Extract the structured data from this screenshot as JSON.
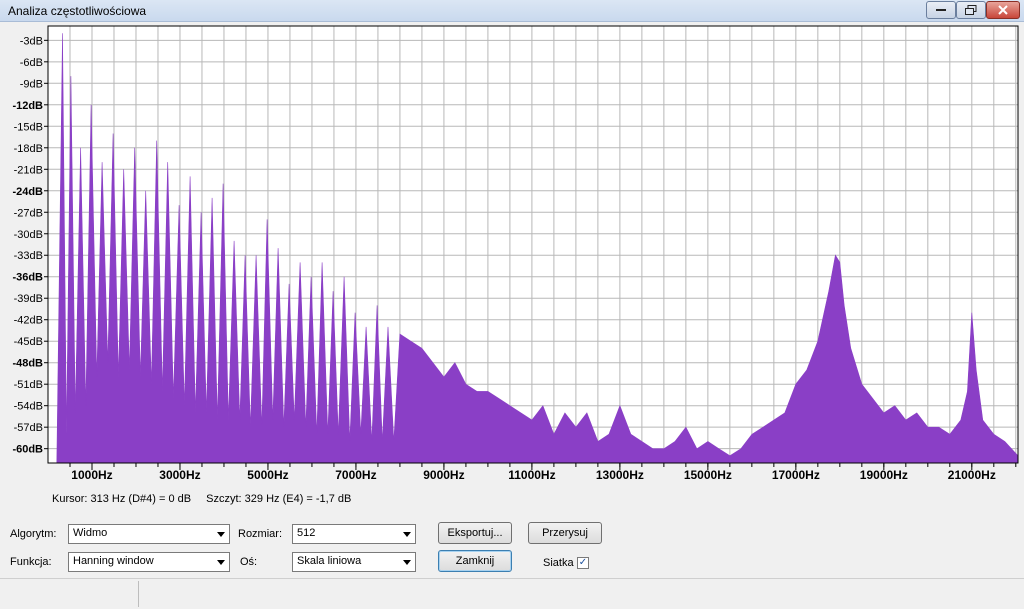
{
  "window": {
    "title": "Analiza częstotliwościowa"
  },
  "chart_data": {
    "type": "area",
    "title": "",
    "xlabel": "",
    "ylabel": "",
    "y_ticks": [
      "-3dB",
      "-6dB",
      "-9dB",
      "-12dB",
      "-15dB",
      "-18dB",
      "-21dB",
      "-24dB",
      "-27dB",
      "-30dB",
      "-33dB",
      "-36dB",
      "-39dB",
      "-42dB",
      "-45dB",
      "-48dB",
      "-51dB",
      "-54dB",
      "-57dB",
      "-60dB"
    ],
    "x_ticks": [
      "1000Hz",
      "3000Hz",
      "5000Hz",
      "7000Hz",
      "9000Hz",
      "11000Hz",
      "13000Hz",
      "15000Hz",
      "17000Hz",
      "19000Hz",
      "21000Hz"
    ],
    "x_unit": "Hz",
    "y_unit": "dB",
    "xlim": [
      0,
      22050
    ],
    "ylim": [
      -62,
      -1
    ],
    "grid": true,
    "color": "#8a3fc6",
    "series": [
      {
        "x": [
          200,
          330,
          420,
          520,
          620,
          740,
          860,
          980,
          1110,
          1230,
          1360,
          1480,
          1600,
          1720,
          1850,
          1970,
          2100,
          2220,
          2350,
          2470,
          2600,
          2720,
          2850,
          2980,
          3100,
          3230,
          3350,
          3480,
          3600,
          3730,
          3850,
          3980,
          4100,
          4230,
          4360,
          4480,
          4600,
          4730,
          4860,
          4980,
          5110,
          5230,
          5360,
          5480,
          5600,
          5730,
          5860,
          5980,
          6110,
          6230,
          6360,
          6480,
          6600,
          6730,
          6860,
          6980,
          7110,
          7230,
          7360,
          7480,
          7600,
          7730,
          7860,
          8000,
          8250,
          8500,
          8750,
          9000,
          9250,
          9500,
          9750,
          10000,
          10250,
          10500,
          10750,
          11000,
          11250,
          11500,
          11750,
          12000,
          12250,
          12500,
          12750,
          13000,
          13250,
          13500,
          13750,
          14000,
          14250,
          14500,
          14750,
          15000,
          15250,
          15500,
          15750,
          16000,
          16250,
          16500,
          16750,
          17000,
          17250,
          17500,
          17750,
          17900,
          18000,
          18100,
          18250,
          18500,
          18750,
          19000,
          19250,
          19500,
          19750,
          20000,
          20250,
          20500,
          20750,
          20900,
          21000,
          21100,
          21250,
          21500,
          21750,
          22050
        ],
        "y": [
          -62,
          -2,
          -58,
          -8,
          -55,
          -18,
          -54,
          -12,
          -50,
          -20,
          -48,
          -16,
          -50,
          -21,
          -49,
          -18,
          -50,
          -24,
          -51,
          -17,
          -52,
          -20,
          -53,
          -26,
          -54,
          -22,
          -55,
          -27,
          -55,
          -25,
          -56,
          -23,
          -56,
          -31,
          -56,
          -33,
          -57,
          -33,
          -57,
          -28,
          -56,
          -32,
          -57,
          -37,
          -56,
          -34,
          -57,
          -36,
          -58,
          -34,
          -58,
          -38,
          -58,
          -36,
          -59,
          -41,
          -58,
          -43,
          -59,
          -40,
          -59,
          -43,
          -59,
          -44,
          -45,
          -46,
          -48,
          -50,
          -48,
          -51,
          -52,
          -52,
          -53,
          -54,
          -55,
          -56,
          -54,
          -58,
          -55,
          -57,
          -55,
          -59,
          -58,
          -54,
          -58,
          -59,
          -60,
          -60,
          -59,
          -57,
          -60,
          -59,
          -60,
          -61,
          -60,
          -58,
          -57,
          -56,
          -55,
          -51,
          -49,
          -45,
          -38,
          -33,
          -34,
          -40,
          -46,
          -51,
          -53,
          -55,
          -54,
          -56,
          -55,
          -57,
          -57,
          -58,
          -56,
          -52,
          -41,
          -49,
          -56,
          -58,
          -59,
          -61
        ]
      }
    ]
  },
  "status": {
    "cursor": "Kursor: 313 Hz (D#4) = 0 dB",
    "peak": "Szczyt: 329 Hz (E4) = -1,7 dB"
  },
  "controls": {
    "algorithm_label": "Algorytm:",
    "algorithm_value": "Widmo",
    "size_label": "Rozmiar:",
    "size_value": "512",
    "function_label": "Funkcja:",
    "function_value": "Hanning window",
    "axis_label": "Oś:",
    "axis_value": "Skala liniowa",
    "export_label": "Eksportuj...",
    "redraw_label": "Przerysuj",
    "close_label": "Zamknij",
    "grid_label": "Siatka",
    "grid_checked": true
  }
}
